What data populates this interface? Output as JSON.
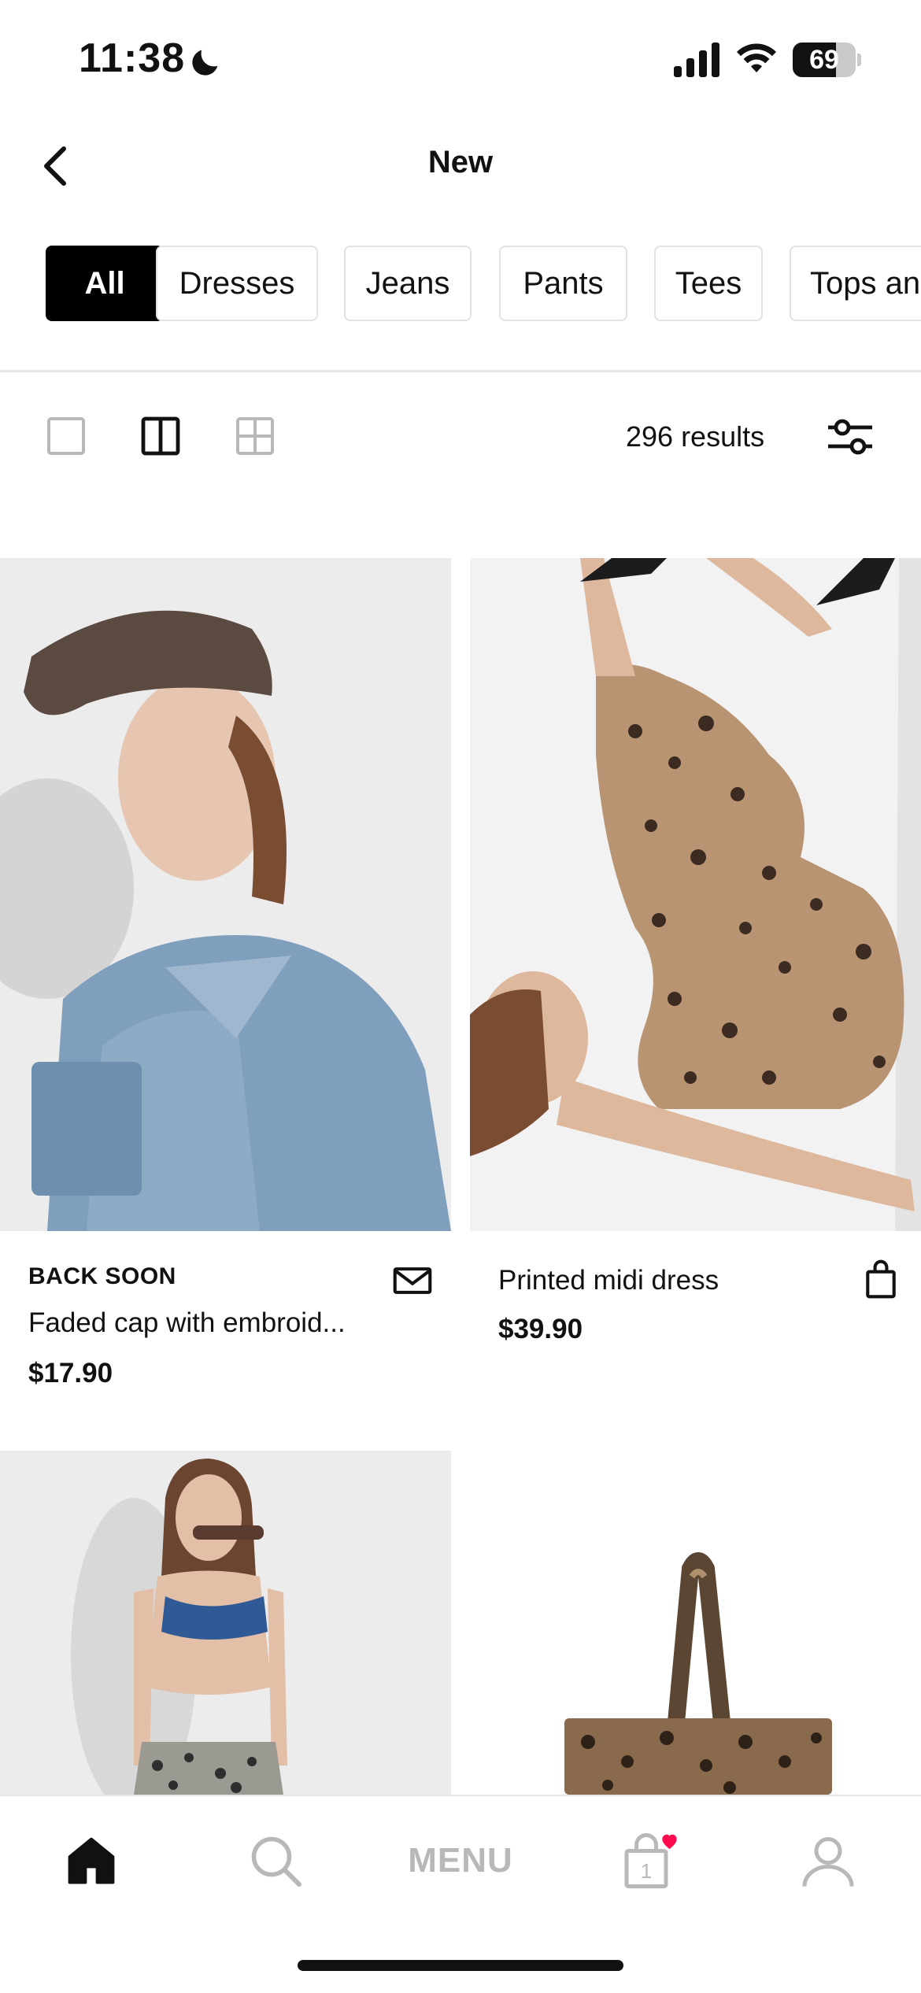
{
  "status_bar": {
    "time": "11:38",
    "battery": "69",
    "battery_level": 0.69,
    "icons": [
      "moon-icon",
      "signal-icon",
      "wifi-icon",
      "battery-icon"
    ]
  },
  "header": {
    "title": "New",
    "back_icon": "chevron-left-icon"
  },
  "categories": [
    {
      "label": "All",
      "active": true
    },
    {
      "label": "Dresses",
      "active": false
    },
    {
      "label": "Jeans",
      "active": false
    },
    {
      "label": "Pants",
      "active": false
    },
    {
      "label": "Tees",
      "active": false
    },
    {
      "label": "Tops and",
      "active": false
    }
  ],
  "toolbar": {
    "views": [
      "single-column-view-icon",
      "two-column-view-icon",
      "four-grid-view-icon"
    ],
    "selected_view": "two-column-view-icon",
    "results_text": "296 results",
    "filter_icon": "filter-sliders-icon"
  },
  "products": [
    {
      "badge": "BACK SOON",
      "name": "Faded cap with embroid...",
      "price": "$17.90",
      "action_icon": "envelope-icon"
    },
    {
      "badge": "",
      "name": "Printed midi dress",
      "price": "$39.90",
      "action_icon": "shopping-bag-icon"
    },
    {
      "badge": "",
      "name": "",
      "price": "",
      "action_icon": ""
    },
    {
      "badge": "",
      "name": "",
      "price": "",
      "action_icon": ""
    }
  ],
  "bottom_nav": {
    "items": [
      {
        "icon": "home-icon",
        "active": true
      },
      {
        "icon": "search-icon",
        "active": false
      },
      {
        "label": "MENU",
        "active": false
      },
      {
        "icon": "bag-icon",
        "badge_count": "1",
        "has_heart": true
      },
      {
        "icon": "profile-icon",
        "active": false
      }
    ]
  },
  "colors": {
    "accent": "#000000",
    "heart": "#ff0a4e",
    "inactive": "#b8b8b8"
  }
}
